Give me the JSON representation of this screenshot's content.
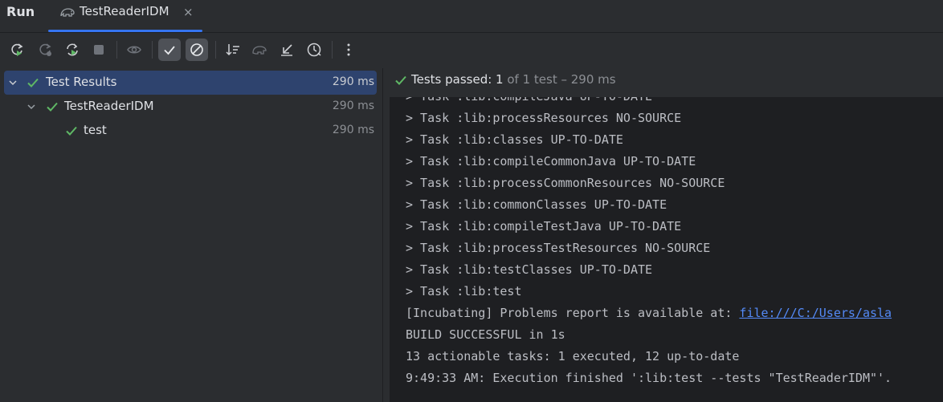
{
  "window": {
    "run_label": "Run"
  },
  "tab": {
    "title": "TestReaderIDM",
    "close": "×",
    "icon": "gradle-elephant-icon"
  },
  "toolbar": {
    "buttons": [
      {
        "name": "rerun-icon"
      },
      {
        "name": "rerun-failed-icon"
      },
      {
        "name": "toggle-auto-test-icon"
      },
      {
        "name": "stop-icon"
      },
      {
        "name": "show-eye-icon"
      },
      {
        "name": "show-passed-icon",
        "active": true
      },
      {
        "name": "show-ignored-icon",
        "active": true
      },
      {
        "name": "sort-icon"
      },
      {
        "name": "import-tests-icon"
      },
      {
        "name": "collapse-icon"
      },
      {
        "name": "history-icon"
      },
      {
        "name": "more-options-icon"
      }
    ]
  },
  "tree": {
    "items": [
      {
        "label": "Test Results",
        "duration": "290 ms",
        "selected": true
      },
      {
        "label": "TestReaderIDM",
        "duration": "290 ms"
      },
      {
        "label": "test",
        "duration": "290 ms"
      }
    ]
  },
  "status": {
    "prefix": "Tests passed: ",
    "count": "1",
    "suffix": " of 1 test – 290 ms"
  },
  "console": {
    "lines": [
      "> Task :lib:compileJava UP-TO-DATE",
      "> Task :lib:processResources NO-SOURCE",
      "> Task :lib:classes UP-TO-DATE",
      "> Task :lib:compileCommonJava UP-TO-DATE",
      "> Task :lib:processCommonResources NO-SOURCE",
      "> Task :lib:commonClasses UP-TO-DATE",
      "> Task :lib:compileTestJava UP-TO-DATE",
      "> Task :lib:processTestResources NO-SOURCE",
      "> Task :lib:testClasses UP-TO-DATE",
      "> Task :lib:test"
    ],
    "problems_prefix": "[Incubating] Problems report is available at: ",
    "problems_link": "file:///C:/Users/asla",
    "build_result": "BUILD SUCCESSFUL in 1s",
    "tasks_summary": "13 actionable tasks: 1 executed, 12 up-to-date",
    "execution_finished": "9:49:33 AM: Execution finished ':lib:test --tests \"TestReaderIDM\"'."
  },
  "colors": {
    "accent": "#3574f0",
    "pass_green": "#5fb865",
    "link": "#548af7",
    "selection": "#2e436e"
  }
}
